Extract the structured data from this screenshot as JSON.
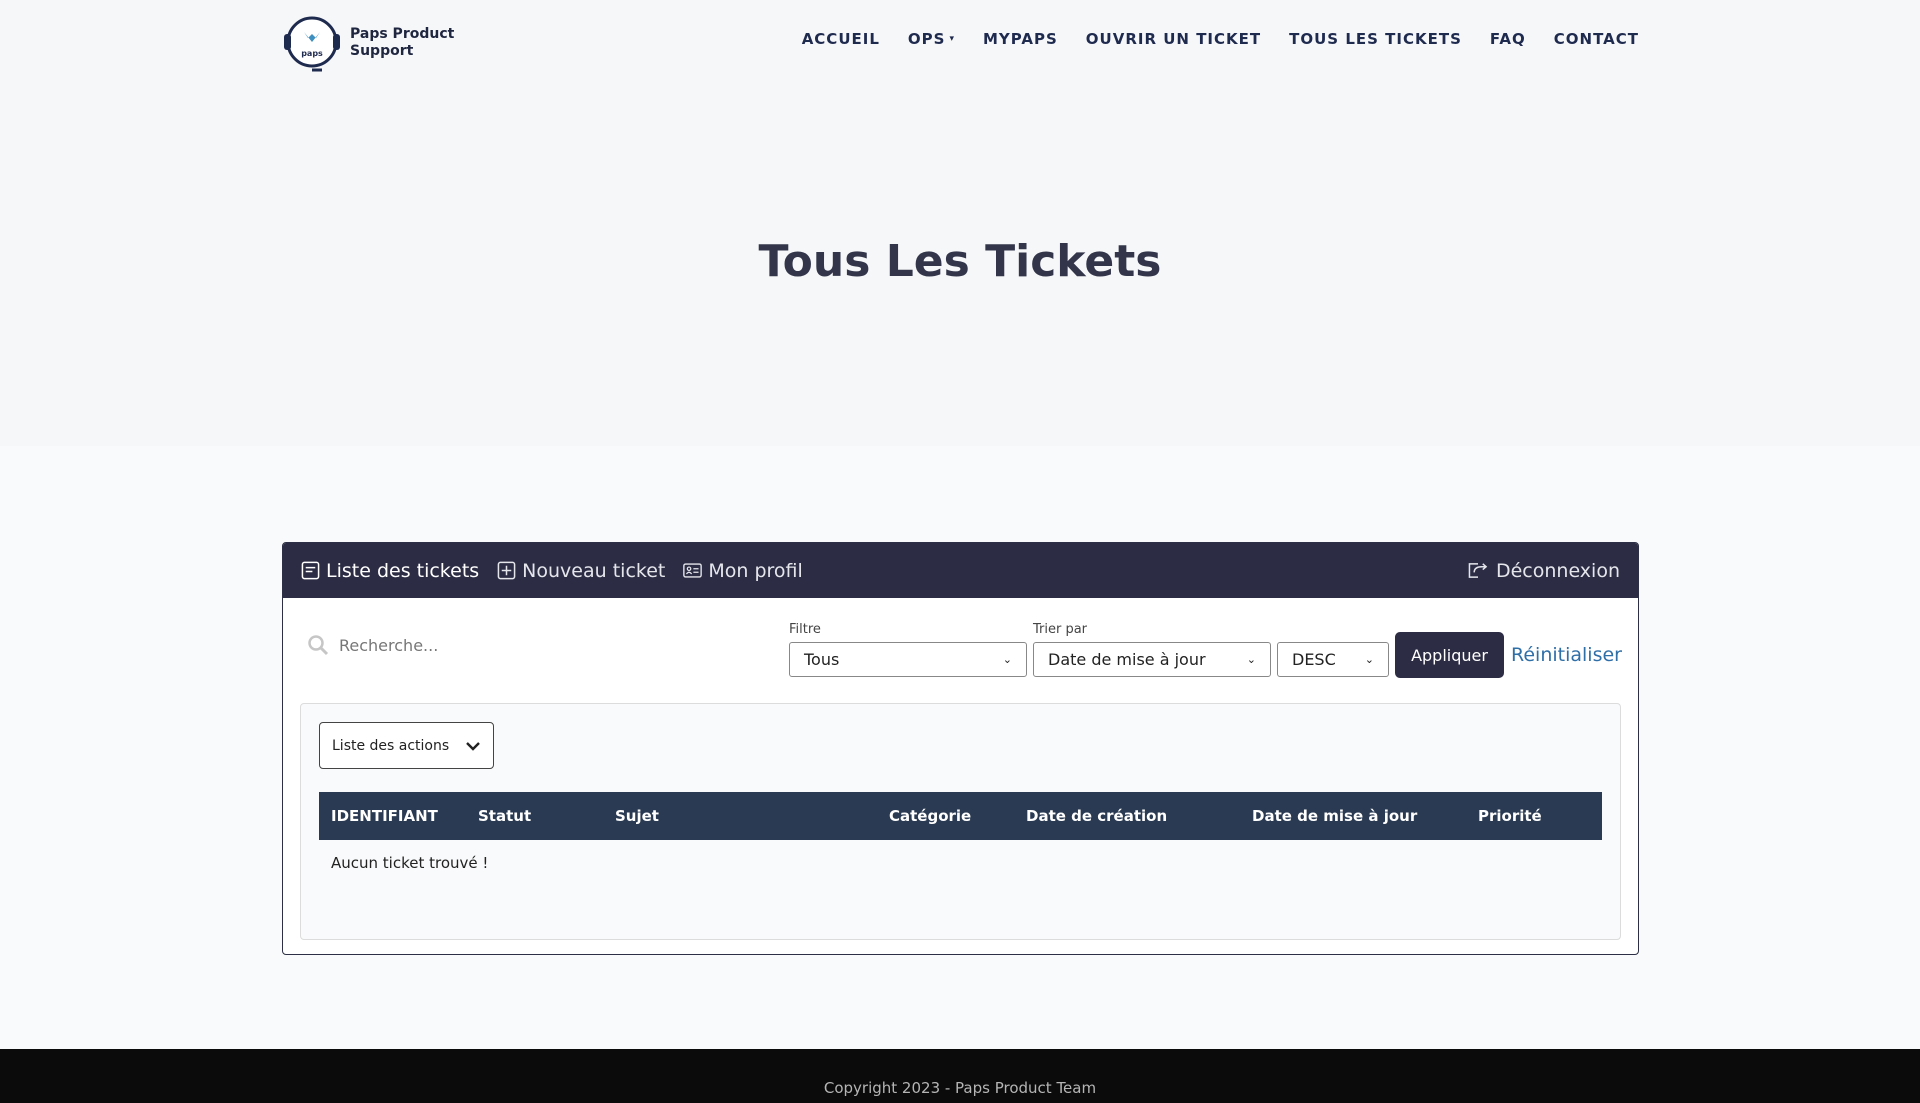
{
  "brand": {
    "name": "Paps Product Support",
    "logo_text": "paps"
  },
  "nav": [
    {
      "label": "ACCUEIL"
    },
    {
      "label": "OPS"
    },
    {
      "label": "MYPAPS"
    },
    {
      "label": "OUVRIR UN TICKET"
    },
    {
      "label": "TOUS LES TICKETS"
    },
    {
      "label": "FAQ"
    },
    {
      "label": "CONTACT"
    }
  ],
  "page_title": "Tous Les Tickets",
  "panel": {
    "tabs": [
      {
        "label": "Liste des tickets",
        "icon": "list-icon"
      },
      {
        "label": "Nouveau ticket",
        "icon": "plus-square-icon"
      },
      {
        "label": "Mon profil",
        "icon": "profile-card-icon"
      }
    ],
    "logout_label": "Déconnexion"
  },
  "controls": {
    "search_placeholder": "Recherche...",
    "filter_label": "Filtre",
    "filter_value": "Tous",
    "sort_label": "Trier par",
    "sort_value": "Date de mise à jour",
    "order_value": "DESC",
    "apply_label": "Appliquer",
    "reset_label": "Réinitialiser"
  },
  "actions_dropdown": "Liste des actions",
  "table": {
    "columns": [
      "IDENTIFIANT",
      "Statut",
      "Sujet",
      "Catégorie",
      "Date de création",
      "Date de mise à jour",
      "Priorité"
    ],
    "empty_message": "Aucun ticket trouvé !"
  },
  "footer": {
    "text": "Copyright 2023 - Paps Product Team"
  },
  "colors": {
    "panel_bar": "#2c2c44",
    "table_header": "#2a3a52",
    "link": "#2f6fa8",
    "footer": "#0b0b0b"
  }
}
